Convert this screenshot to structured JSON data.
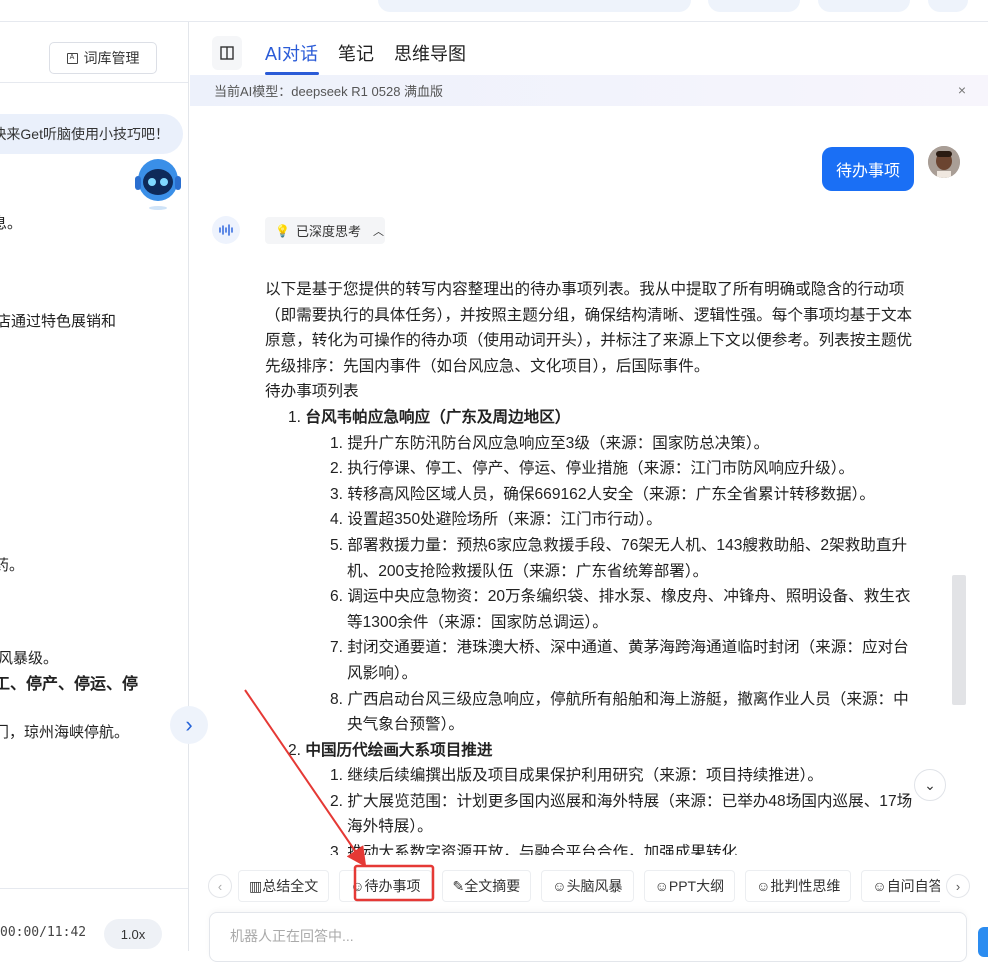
{
  "colors": {
    "accent": "#2a5bd7",
    "user_bubble": "#1a6ff5",
    "annotation": "#e53935"
  },
  "left_panel": {
    "library_button": "词库管理",
    "tip": "快来Get听脑使用小技巧吧！",
    "fragments": [
      "信息。",
      "店通过特色展销和",
      "药。",
      "风暴级。",
      "工、停产、停运、停",
      "门，琼州海峡停航。"
    ],
    "time": "00:00/11:42",
    "speed": "1.0x"
  },
  "tabs": [
    {
      "label": "AI对话",
      "active": true
    },
    {
      "label": "笔记"
    },
    {
      "label": "思维导图"
    }
  ],
  "banner": {
    "text": "当前AI模型：deepseek R1 0528 满血版",
    "close": "×"
  },
  "chat": {
    "user_message": "待办事项",
    "thinking_label": "已深度思考",
    "intro": "以下是基于您提供的转写内容整理出的待办事项列表。我从中提取了所有明确或隐含的行动项（即需要执行的具体任务），并按照主题分组，确保结构清晰、逻辑性强。每个事项均基于文本原意，转化为可操作的待办项（使用动词开头），并标注了来源上下文以便参考。列表按主题优先级排序：先国内事件（如台风应急、文化项目），后国际事件。",
    "list_title": "待办事项列表",
    "sections": [
      {
        "num": "1.",
        "title": "台风韦帕应急响应（广东及周边地区）",
        "items": [
          "提升广东防汛防台风应急响应至3级（来源：国家防总决策）。",
          "执行停课、停工、停产、停运、停业措施（来源：江门市防风响应升级）。",
          "转移高风险区域人员，确保669162人安全（来源：广东全省累计转移数据）。",
          "设置超350处避险场所（来源：江门市行动）。",
          "部署救援力量：预热6家应急救援手段、76架无人机、143艘救助船、2架救助直升机、200支抢险救援队伍（来源：广东省统筹部署）。",
          "调运中央应急物资：20万条编织袋、排水泵、橡皮舟、冲锋舟、照明设备、救生衣等1300余件（来源：国家防总调运）。",
          "封闭交通要道：港珠澳大桥、深中通道、黄茅海跨海通道临时封闭（来源：应对台风影响）。",
          "广西启动台风三级应急响应，停航所有船舶和海上游艇，撤离作业人员（来源：中央气象台预警）。"
        ]
      },
      {
        "num": "2.",
        "title": "中国历代绘画大系项目推进",
        "items": [
          "继续后续编撰出版及项目成果保护利用研究（来源：项目持续推进）。",
          "扩大展览范围：计划更多国内巡展和海外特展（来源：已举办48场国内巡展、17场海外特展）。",
          "推动大系数字资源开放，与融合平台合作，加强成果转化……"
        ]
      }
    ]
  },
  "quick_actions": [
    {
      "icon": "chart-icon",
      "label": "总结全文"
    },
    {
      "icon": "smile-icon",
      "label": "待办事项",
      "highlighted": true
    },
    {
      "icon": "edit-icon",
      "label": "全文摘要"
    },
    {
      "icon": "smile-icon",
      "label": "头脑风暴"
    },
    {
      "icon": "smile-icon",
      "label": "PPT大纲"
    },
    {
      "icon": "smile-icon",
      "label": "批判性思维"
    },
    {
      "icon": "smile-icon",
      "label": "自问自答"
    }
  ],
  "input": {
    "placeholder": "机器人正在回答中..."
  }
}
